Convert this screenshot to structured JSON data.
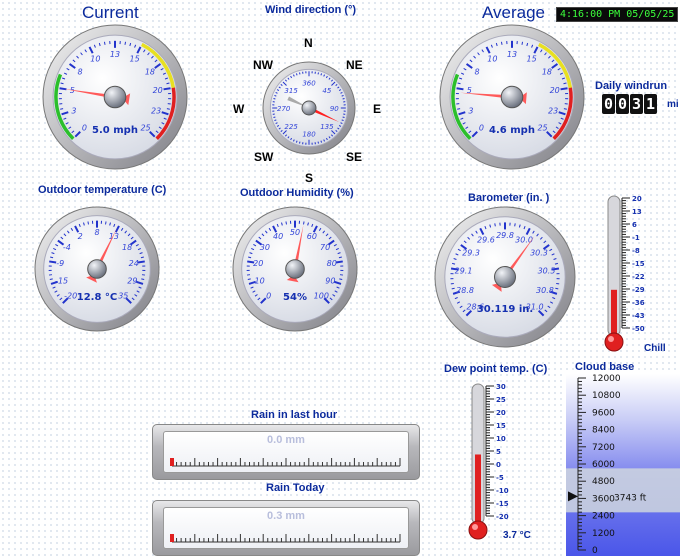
{
  "clock": "4:16:00 PM 05/05/25",
  "current": {
    "title": "Current",
    "value": "5.0 mph",
    "reading": 5.0,
    "ticks": [
      "0",
      "3",
      "5",
      "8",
      "10",
      "13",
      "15",
      "18",
      "20",
      "23",
      "25"
    ]
  },
  "average": {
    "title": "Average",
    "value": "4.6 mph",
    "reading": 4.6,
    "ticks": [
      "0",
      "3",
      "5",
      "8",
      "10",
      "13",
      "15",
      "18",
      "20",
      "23",
      "25"
    ]
  },
  "wind_direction": {
    "title": "Wind direction (°)",
    "points": [
      "N",
      "NE",
      "E",
      "SE",
      "S",
      "SW",
      "W",
      "NW"
    ],
    "ticks": [
      "360",
      "45",
      "90",
      "135",
      "180",
      "225",
      "270",
      "315"
    ],
    "bearing": 115
  },
  "windrun": {
    "title": "Daily windrun",
    "digits": [
      "0",
      "0",
      "3",
      "1"
    ],
    "unit": "mi"
  },
  "temperature": {
    "title": "Outdoor temperature (C)",
    "value": "12.8 °C",
    "reading": 12.8,
    "ticks": [
      "-20",
      "-15",
      "-9",
      "-4",
      "2",
      "8",
      "13",
      "18",
      "24",
      "29",
      "35"
    ]
  },
  "humidity": {
    "title": "Outdoor Humidity (%)",
    "value": "54%",
    "reading": 54,
    "ticks": [
      "0",
      "10",
      "20",
      "30",
      "40",
      "50",
      "60",
      "70",
      "80",
      "90",
      "100"
    ]
  },
  "barometer": {
    "title": "Barometer (in. )",
    "value": "30.119 in.",
    "reading": 30.119,
    "ticks": [
      "28.6",
      "28.8",
      "29.1",
      "29.3",
      "29.6",
      "29.8",
      "30.0",
      "30.3",
      "30.5",
      "30.8",
      "31.0"
    ]
  },
  "chill": {
    "label": "Chill",
    "ticks": [
      "20",
      "13",
      "6",
      "-1",
      "-8",
      "-15",
      "-22",
      "-29",
      "-36",
      "-43",
      "-50"
    ]
  },
  "dewpoint": {
    "title": "Dew point temp. (C)",
    "value": "3.7 °C",
    "reading": 3.7,
    "ticks": [
      "30",
      "25",
      "20",
      "15",
      "10",
      "5",
      "0",
      "-5",
      "-10",
      "-15",
      "-20"
    ]
  },
  "cloudbase": {
    "title": "Cloud base",
    "value": "3743 ft",
    "reading": 3743,
    "ticks": [
      "12000",
      "10800",
      "9600",
      "8400",
      "7200",
      "6000",
      "4800",
      "3600",
      "2400",
      "1200",
      "0"
    ]
  },
  "rain_hour": {
    "title": "Rain in last hour",
    "value": "0.0 mm"
  },
  "rain_today": {
    "title": "Rain Today",
    "value": "0.3 mm"
  },
  "colors": {
    "title": "#0b2a9c",
    "needle": "#ff5a5a",
    "mercury": "#e02020"
  }
}
